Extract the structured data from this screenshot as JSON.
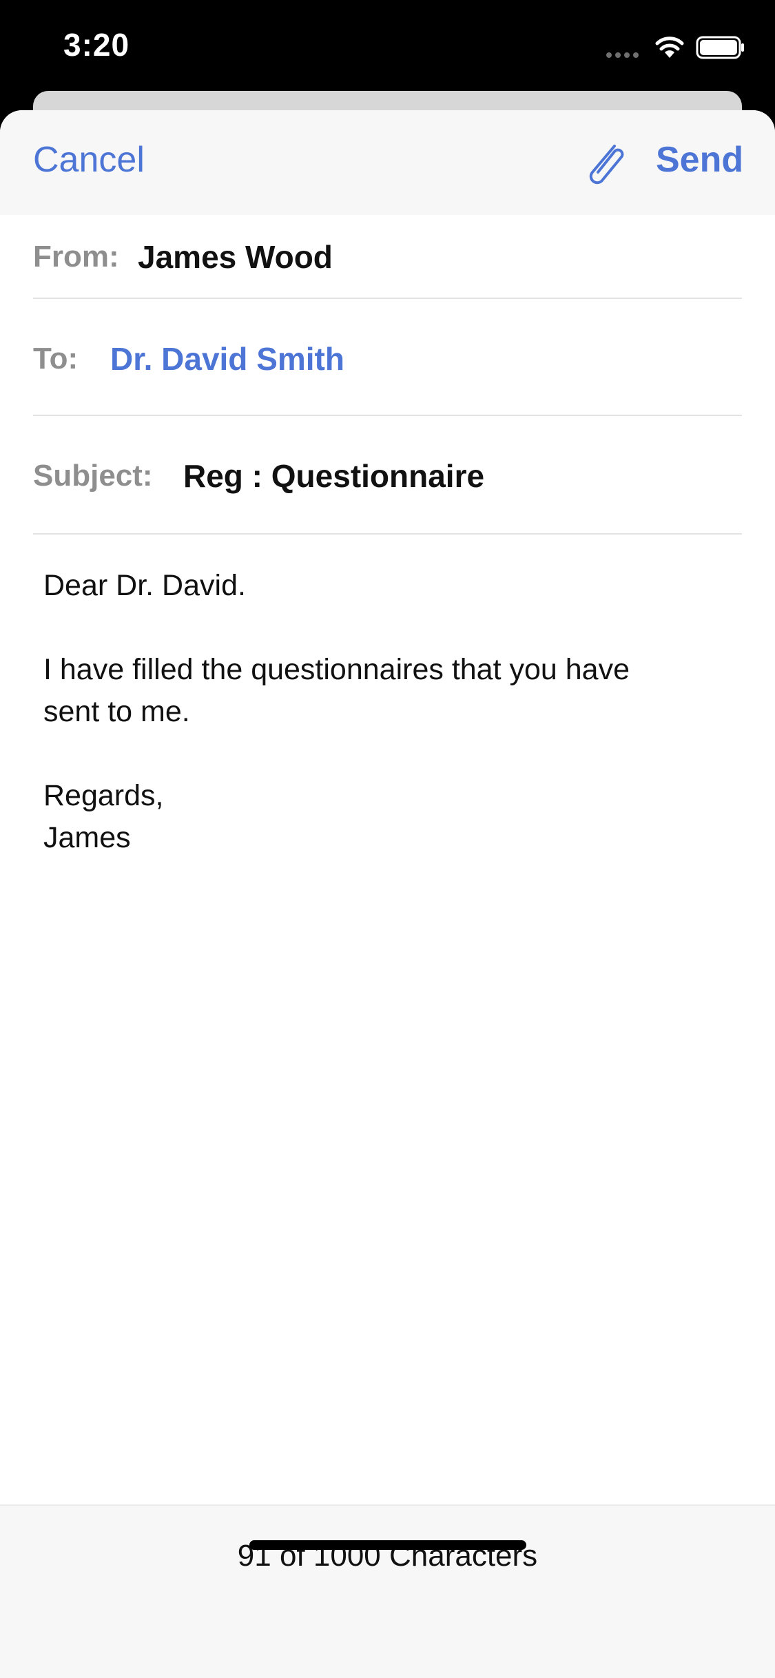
{
  "status_bar": {
    "time": "3:20",
    "wifi_icon": "wifi-icon",
    "battery_icon": "battery-icon"
  },
  "nav": {
    "cancel_label": "Cancel",
    "attach_icon": "paperclip-icon",
    "send_label": "Send"
  },
  "fields": {
    "from_label": "From:",
    "from_value": "James Wood",
    "to_label": "To:",
    "to_value": "Dr. David Smith",
    "subject_label": "Subject:",
    "subject_value": "Reg : Questionnaire"
  },
  "body": {
    "line1": "Dear Dr. David.",
    "line2": "I have filled the questionnaires that you have",
    "line3": "sent to me.",
    "line4": "Regards,",
    "line5": "James"
  },
  "footer": {
    "char_count": "91 of 1000 Characters"
  },
  "colors": {
    "accent": "#4c75d6",
    "label_gray": "#8e8e8e",
    "bar_background": "#f7f7f7"
  }
}
